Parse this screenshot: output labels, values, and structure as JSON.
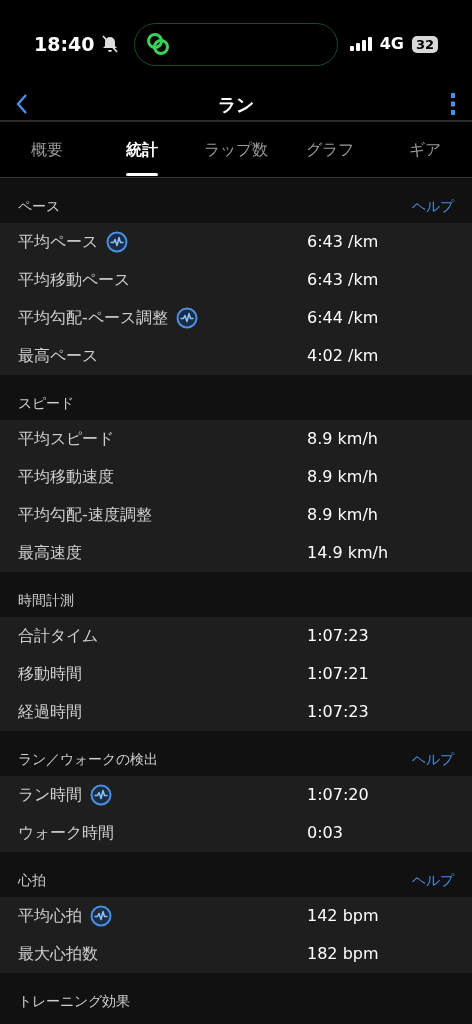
{
  "status_bar": {
    "time": "18:40",
    "network": "4G",
    "battery": "32"
  },
  "header": {
    "title": "ラン"
  },
  "tabs": [
    {
      "label": "概要",
      "selected": false
    },
    {
      "label": "統計",
      "selected": true
    },
    {
      "label": "ラップ数",
      "selected": false
    },
    {
      "label": "グラフ",
      "selected": false
    },
    {
      "label": "ギア",
      "selected": false
    }
  ],
  "sections": [
    {
      "title": "ペース",
      "help": "ヘルプ",
      "rows": [
        {
          "label": "平均ペース",
          "value": "6:43 /km",
          "chart_link": true
        },
        {
          "label": "平均移動ペース",
          "value": "6:43 /km",
          "chart_link": false
        },
        {
          "label": "平均勾配-ペース調整",
          "value": "6:44 /km",
          "chart_link": true
        },
        {
          "label": "最高ペース",
          "value": "4:02 /km",
          "chart_link": false
        }
      ]
    },
    {
      "title": "スピード",
      "rows": [
        {
          "label": "平均スピード",
          "value": "8.9 km/h",
          "chart_link": false
        },
        {
          "label": "平均移動速度",
          "value": "8.9 km/h",
          "chart_link": false
        },
        {
          "label": "平均勾配-速度調整",
          "value": "8.9 km/h",
          "chart_link": false
        },
        {
          "label": "最高速度",
          "value": "14.9 km/h",
          "chart_link": false
        }
      ]
    },
    {
      "title": "時間計測",
      "rows": [
        {
          "label": "合計タイム",
          "value": "1:07:23",
          "chart_link": false
        },
        {
          "label": "移動時間",
          "value": "1:07:21",
          "chart_link": false
        },
        {
          "label": "経過時間",
          "value": "1:07:23",
          "chart_link": false
        }
      ]
    },
    {
      "title": "ラン／ウォークの検出",
      "help": "ヘルプ",
      "rows": [
        {
          "label": "ラン時間",
          "value": "1:07:20",
          "chart_link": true
        },
        {
          "label": "ウォーク時間",
          "value": "0:03",
          "chart_link": false
        }
      ]
    },
    {
      "title": "心拍",
      "help": "ヘルプ",
      "rows": [
        {
          "label": "平均心拍",
          "value": "142 bpm",
          "chart_link": true
        },
        {
          "label": "最大心拍数",
          "value": "182 bpm",
          "chart_link": false
        }
      ]
    },
    {
      "title": "トレーニング効果"
    }
  ]
}
